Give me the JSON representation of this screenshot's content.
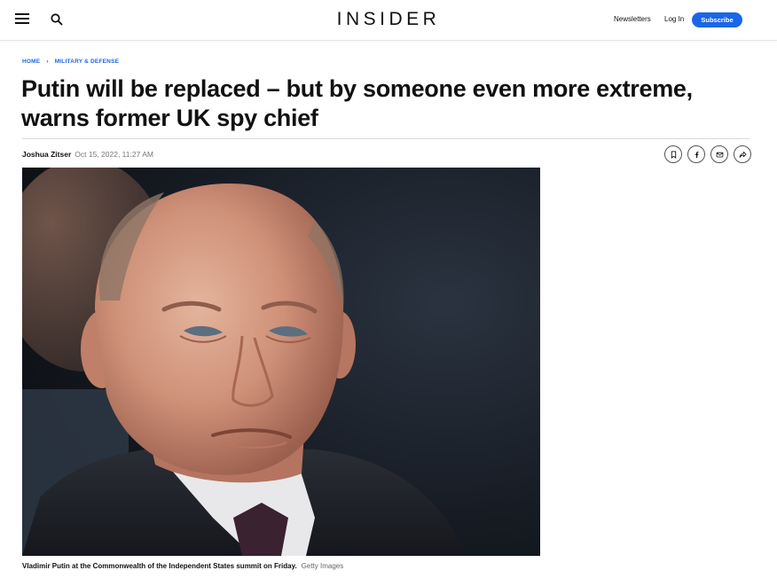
{
  "header": {
    "logo": "INSIDER",
    "newsletters": "Newsletters",
    "login": "Log In",
    "subscribe": "Subscribe"
  },
  "breadcrumb": {
    "home": "HOME",
    "section": "MILITARY & DEFENSE"
  },
  "article": {
    "headline": "Putin will be replaced – but by someone even more extreme, warns former UK spy chief",
    "author": "Joshua Zitser",
    "date": "Oct 15, 2022, 11:27 AM",
    "caption": "Vladimir Putin at the Commonwealth of the Independent States summit on Friday.",
    "credit": "Getty Images"
  },
  "colors": {
    "accent": "#1a66e8"
  },
  "icons": [
    "menu-icon",
    "search-icon",
    "bookmark-icon",
    "facebook-icon",
    "email-icon",
    "share-icon"
  ]
}
